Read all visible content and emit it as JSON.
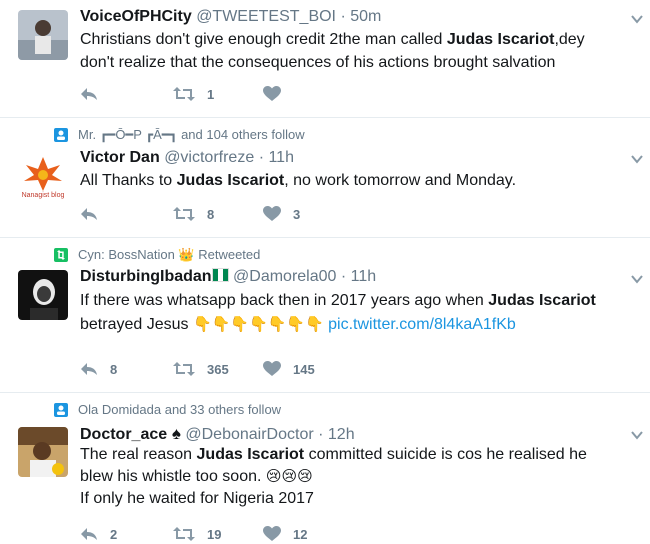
{
  "tweets": [
    {
      "name": "VoiceOfPHCity",
      "handle": "@TWEETEST_BOI",
      "time": "· 50m",
      "text_parts": [
        "Christians don't give enough credit 2the man called ",
        "Judas Iscariot",
        ",dey don't realize that the consequences of his actions brought salvation"
      ],
      "retweets": "1",
      "likes": ""
    },
    {
      "context": "Mr. ┏━Ō━P ┏Ā━┓ and 104 others follow",
      "name": "Victor Dan",
      "handle": "@victorfreze",
      "time": "· 11h",
      "text_parts": [
        "All Thanks to ",
        "Judas Iscariot",
        ", no work tomorrow and Monday."
      ],
      "avatar_text": "Nanagist blog",
      "retweets": "8",
      "likes": "3"
    },
    {
      "context": "Cyn: BossNation 👑 Retweeted",
      "name": "DisturbingIbadan",
      "handle": "@Damorela00",
      "time": "· 11h",
      "text_parts": [
        "If there was whatsapp back then in 2017 years ago when ",
        "Judas Iscariot",
        " betrayed Jesus "
      ],
      "emojis": "👇👇👇👇👇👇👇",
      "link": "pic.twitter.com/8l4kaA1fKb",
      "replies": "8",
      "retweets": "365",
      "likes": "145"
    },
    {
      "context": "Ola Domidada and 33 others follow",
      "name": "Doctor_ace",
      "handle": "@DebonairDoctor",
      "time": "· 12h",
      "text_parts": [
        "The real reason ",
        "Judas Iscariot",
        " committed suicide is cos he realised he blew his whistle too soon. "
      ],
      "emojis": "😢😢😢",
      "text_extra": "If only he waited for Nigeria 2017",
      "replies": "2",
      "retweets": "19",
      "likes": "12"
    }
  ],
  "colors": {
    "accent": "#1b95e0",
    "muted": "#657786",
    "retweet_green": "#17bf63"
  }
}
